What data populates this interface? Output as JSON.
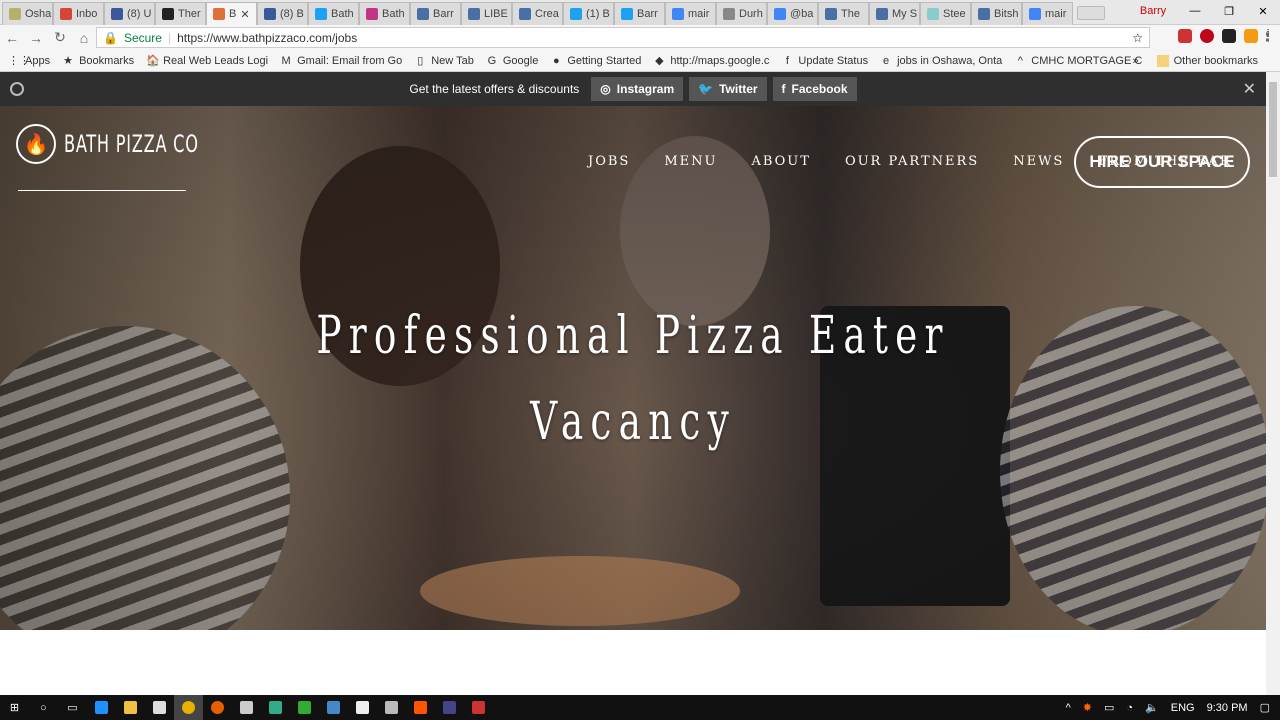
{
  "browser": {
    "tabs": [
      {
        "label": "Osha",
        "color": "#b5b06a"
      },
      {
        "label": "Inbo",
        "color": "#d44638"
      },
      {
        "label": "(8) U",
        "color": "#3b5998"
      },
      {
        "label": "Ther",
        "color": "#222"
      },
      {
        "label": "B",
        "color": "#e0703a",
        "active": true
      },
      {
        "label": "(8) B",
        "color": "#3b5998"
      },
      {
        "label": "Bath",
        "color": "#1da1f2"
      },
      {
        "label": "Bath",
        "color": "#c13584"
      },
      {
        "label": "Barr",
        "color": "#4a6fa5"
      },
      {
        "label": "LIBE",
        "color": "#4a6fa5"
      },
      {
        "label": "Crea",
        "color": "#4a6fa5"
      },
      {
        "label": "(1) B",
        "color": "#1da1f2"
      },
      {
        "label": "Barr",
        "color": "#1da1f2"
      },
      {
        "label": "mair",
        "color": "#4285f4"
      },
      {
        "label": "Durh",
        "color": "#888"
      },
      {
        "label": "@ba",
        "color": "#4285f4"
      },
      {
        "label": "The",
        "color": "#4a6fa5"
      },
      {
        "label": "My S",
        "color": "#4a6fa5"
      },
      {
        "label": "Stee",
        "color": "#8cc"
      },
      {
        "label": "Bitsh",
        "color": "#4a6fa5"
      },
      {
        "label": "mair",
        "color": "#4285f4"
      }
    ],
    "profile": "Barry",
    "secure_label": "Secure",
    "url": "https://www.bathpizzaco.com/jobs",
    "bookmarks": [
      "Apps",
      "Bookmarks",
      "Real Web Leads Logi",
      "Gmail: Email from Go",
      "New Tab",
      "Google",
      "Getting Started",
      "http://maps.google.c",
      "Update Status",
      "jobs in Oshawa, Onta",
      "CMHC MORTGAGE C"
    ],
    "other_bookmarks": "Other bookmarks"
  },
  "site": {
    "banner": {
      "text": "Get the latest offers & discounts",
      "instagram": "Instagram",
      "twitter": "Twitter",
      "facebook": "Facebook"
    },
    "logo": "BATH PIZZA CO",
    "menu": [
      "JOBS",
      "MENU",
      "ABOUT",
      "OUR PARTNERS",
      "NEWS",
      "FROM THE BAR"
    ],
    "hire": "HIRE OUR SPACE",
    "headline1": "Professional Pizza Eater",
    "headline2": "Vacancy"
  },
  "taskbar": {
    "lang": "ENG",
    "time": "9:30 PM"
  }
}
